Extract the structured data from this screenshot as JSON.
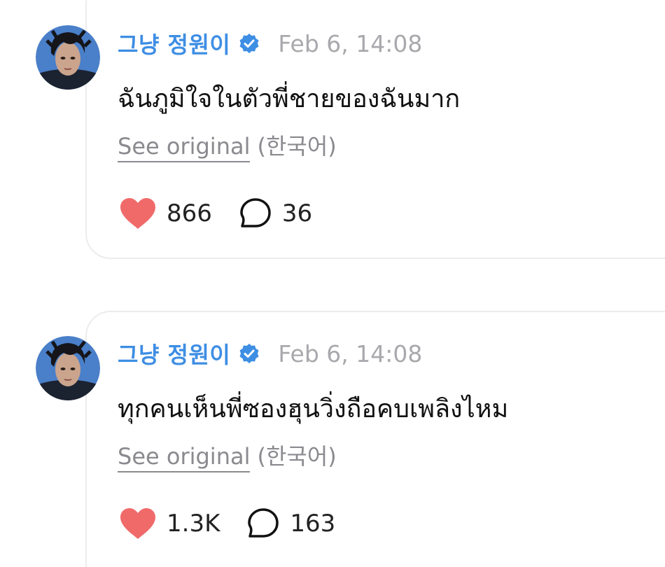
{
  "colors": {
    "username": "#3e8ee4",
    "verified_badge": "#3e8ee4",
    "timestamp": "#a9a9ad",
    "heart": "#f06a6a",
    "card_border": "#ececee"
  },
  "comments": [
    {
      "author": "그냥 정원이",
      "verified_icon": "verified-badge-icon",
      "timestamp": "Feb 6, 14:08",
      "text": "ฉันภูมิใจในตัวพี่ชายของฉันมาก",
      "see_original": "See original",
      "original_language": "(한국어)",
      "likes": "866",
      "replies": "36"
    },
    {
      "author": "그냥 정원이",
      "verified_icon": "verified-badge-icon",
      "timestamp": "Feb 6, 14:08",
      "text": "ทุกคนเห็นพี่ซองฮุนวิ่งถือคบเพลิงไหม",
      "see_original": "See original",
      "original_language": "(한국어)",
      "likes": "1.3K",
      "replies": "163"
    }
  ]
}
